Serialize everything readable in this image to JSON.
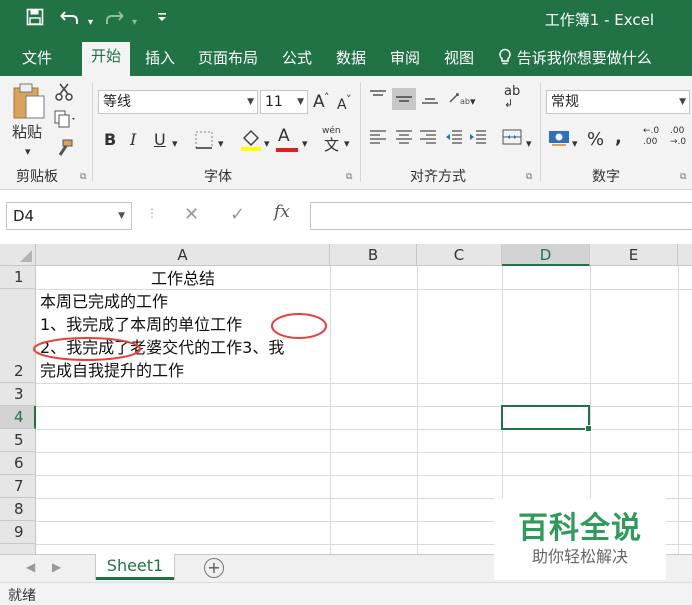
{
  "titlebar": {
    "save_icon": "save-icon",
    "undo_icon": "undo-icon",
    "redo_icon": "redo-icon",
    "customize_icon": "customize-qat-icon",
    "title": "工作簿1 - Excel"
  },
  "tabs": {
    "file": "文件",
    "home": "开始",
    "insert": "插入",
    "layout": "页面布局",
    "formulas": "公式",
    "data": "数据",
    "review": "审阅",
    "view": "视图",
    "tell_me": "告诉我你想要做什么"
  },
  "ribbon": {
    "clipboard": {
      "paste": "粘贴",
      "label": "剪贴板"
    },
    "font": {
      "name": "等线",
      "size": "11",
      "bold": "B",
      "italic": "I",
      "underline": "U",
      "grow": "A",
      "shrink": "A",
      "phonetic": "wén",
      "phonetic_char": "文",
      "font_color_letter": "A",
      "label": "字体"
    },
    "alignment": {
      "wrap": "ab",
      "label": "对齐方式"
    },
    "number": {
      "format": "常规",
      "percent": "%",
      "comma": ",",
      "inc_decimal": "←.0 .00",
      "dec_decimal": ".00 →.0",
      "label": "数字"
    }
  },
  "formula_bar": {
    "name_box": "D4",
    "cancel": "✕",
    "enter": "✓",
    "fx": "fx",
    "content": ""
  },
  "grid": {
    "columns": [
      "A",
      "B",
      "C",
      "D",
      "E"
    ],
    "selected_column": "D",
    "rows": [
      "1",
      "2",
      "3",
      "4",
      "5",
      "6",
      "7",
      "8",
      "9"
    ],
    "selected_row": "4",
    "cells": {
      "A1": "工作总结",
      "A2_line1": "本周已完成的工作",
      "A2_line2": "1、我完成了本周的单位工作",
      "A2_line3": "2、我完成了老婆交代的工作3、我",
      "A2_line4": "完成自我提升的工作"
    },
    "annotation_color": "#e8403a"
  },
  "sheets": {
    "tabs": [
      "Sheet1"
    ],
    "add": "+"
  },
  "status": {
    "text": "就绪"
  },
  "watermark": {
    "title": "百科全说",
    "subtitle": "助你轻松解决"
  },
  "colors": {
    "accent": "#217346",
    "ribbon_bg": "#f3f3f3",
    "header_bg": "#e6e6e6",
    "watermark_green": "#2e9b5a"
  }
}
